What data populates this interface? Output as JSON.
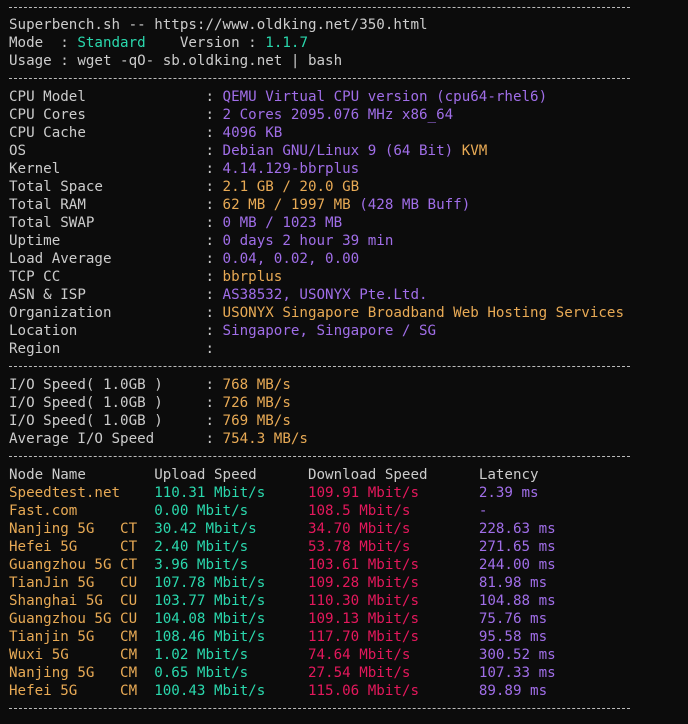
{
  "colors": {
    "background": "#0c0c0c",
    "text": "#cccccc",
    "green": "#2ad8ad",
    "purple": "#a06ee8",
    "yellow": "#e8aa55",
    "red": "#e4185c"
  },
  "header": {
    "title": "Superbench.sh -- https://www.oldking.net/350.html",
    "mode_label": "Mode",
    "mode_value": "Standard",
    "version_label": "Version",
    "version_value": "1.1.7",
    "usage_label": "Usage",
    "usage_value": "wget -qO- sb.oldking.net | bash"
  },
  "system_info": [
    {
      "label": "CPU Model",
      "value": "QEMU Virtual CPU version (cpu64-rhel6)",
      "color": "purple"
    },
    {
      "label": "CPU Cores",
      "value": "2 Cores 2095.076 MHz x86_64",
      "color": "purple"
    },
    {
      "label": "CPU Cache",
      "value": "4096 KB",
      "color": "purple"
    },
    {
      "label": "OS",
      "value": "Debian GNU/Linux 9 (64 Bit)",
      "color": "purple",
      "extra": "KVM",
      "extra_color": "yellow"
    },
    {
      "label": "Kernel",
      "value": "4.14.129-bbrplus",
      "color": "purple"
    },
    {
      "label": "Total Space",
      "value": "2.1 GB / 20.0 GB",
      "color": "yellow"
    },
    {
      "label": "Total RAM",
      "value": "62 MB / 1997 MB",
      "color": "yellow",
      "extra": "(428 MB Buff)",
      "extra_color": "purple"
    },
    {
      "label": "Total SWAP",
      "value": "0 MB / 1023 MB",
      "color": "purple"
    },
    {
      "label": "Uptime",
      "value": "0 days 2 hour 39 min",
      "color": "purple"
    },
    {
      "label": "Load Average",
      "value": "0.04, 0.02, 0.00",
      "color": "purple"
    },
    {
      "label": "TCP CC",
      "value": "bbrplus",
      "color": "yellow"
    },
    {
      "label": "ASN & ISP",
      "value": "AS38532, USONYX Pte.Ltd.",
      "color": "purple"
    },
    {
      "label": "Organization",
      "value": "USONYX Singapore Broadband Web Hosting Services",
      "color": "yellow"
    },
    {
      "label": "Location",
      "value": "Singapore, Singapore / SG",
      "color": "purple"
    },
    {
      "label": "Region",
      "value": "",
      "color": "purple"
    }
  ],
  "io": [
    {
      "label": "I/O Speed( 1.0GB )",
      "value": "768 MB/s"
    },
    {
      "label": "I/O Speed( 1.0GB )",
      "value": "726 MB/s"
    },
    {
      "label": "I/O Speed( 1.0GB )",
      "value": "769 MB/s"
    },
    {
      "label": "Average I/O Speed",
      "value": "754.3 MB/s"
    }
  ],
  "speedtest": {
    "headers": {
      "node": "Node Name",
      "upload": "Upload Speed",
      "download": "Download Speed",
      "latency": "Latency"
    },
    "rows": [
      {
        "node": "Speedtest.net",
        "isp": "",
        "node_color": "yellow",
        "upload": "110.31 Mbit/s",
        "download": "109.91 Mbit/s",
        "latency": "2.39 ms"
      },
      {
        "node": "Fast.com",
        "isp": "",
        "node_color": "yellow",
        "upload": "0.00 Mbit/s",
        "download": "108.5 Mbit/s",
        "latency": "-"
      },
      {
        "node": "Nanjing 5G",
        "isp": "CT",
        "node_color": "yellow",
        "upload": "30.42 Mbit/s",
        "download": "34.70 Mbit/s",
        "latency": "228.63 ms"
      },
      {
        "node": "Hefei 5G",
        "isp": "CT",
        "node_color": "yellow",
        "upload": "2.40 Mbit/s",
        "download": "53.78 Mbit/s",
        "latency": "271.65 ms"
      },
      {
        "node": "Guangzhou 5G",
        "isp": "CT",
        "node_color": "yellow",
        "upload": "3.96 Mbit/s",
        "download": "103.61 Mbit/s",
        "latency": "244.00 ms"
      },
      {
        "node": "TianJin 5G",
        "isp": "CU",
        "node_color": "yellow",
        "upload": "107.78 Mbit/s",
        "download": "109.28 Mbit/s",
        "latency": "81.98 ms"
      },
      {
        "node": "Shanghai 5G",
        "isp": "CU",
        "node_color": "yellow",
        "upload": "103.77 Mbit/s",
        "download": "110.30 Mbit/s",
        "latency": "104.88 ms"
      },
      {
        "node": "Guangzhou 5G",
        "isp": "CU",
        "node_color": "yellow",
        "upload": "104.08 Mbit/s",
        "download": "109.13 Mbit/s",
        "latency": "75.76 ms"
      },
      {
        "node": "Tianjin 5G",
        "isp": "CM",
        "node_color": "yellow",
        "upload": "108.46 Mbit/s",
        "download": "117.70 Mbit/s",
        "latency": "95.58 ms"
      },
      {
        "node": "Wuxi 5G",
        "isp": "CM",
        "node_color": "yellow",
        "upload": "1.02 Mbit/s",
        "download": "74.64 Mbit/s",
        "latency": "300.52 ms"
      },
      {
        "node": "Nanjing 5G",
        "isp": "CM",
        "node_color": "yellow",
        "upload": "0.65 Mbit/s",
        "download": "27.54 Mbit/s",
        "latency": "107.33 ms"
      },
      {
        "node": "Hefei 5G",
        "isp": "CM",
        "node_color": "yellow",
        "upload": "100.43 Mbit/s",
        "download": "115.06 Mbit/s",
        "latency": "89.89 ms"
      }
    ]
  }
}
